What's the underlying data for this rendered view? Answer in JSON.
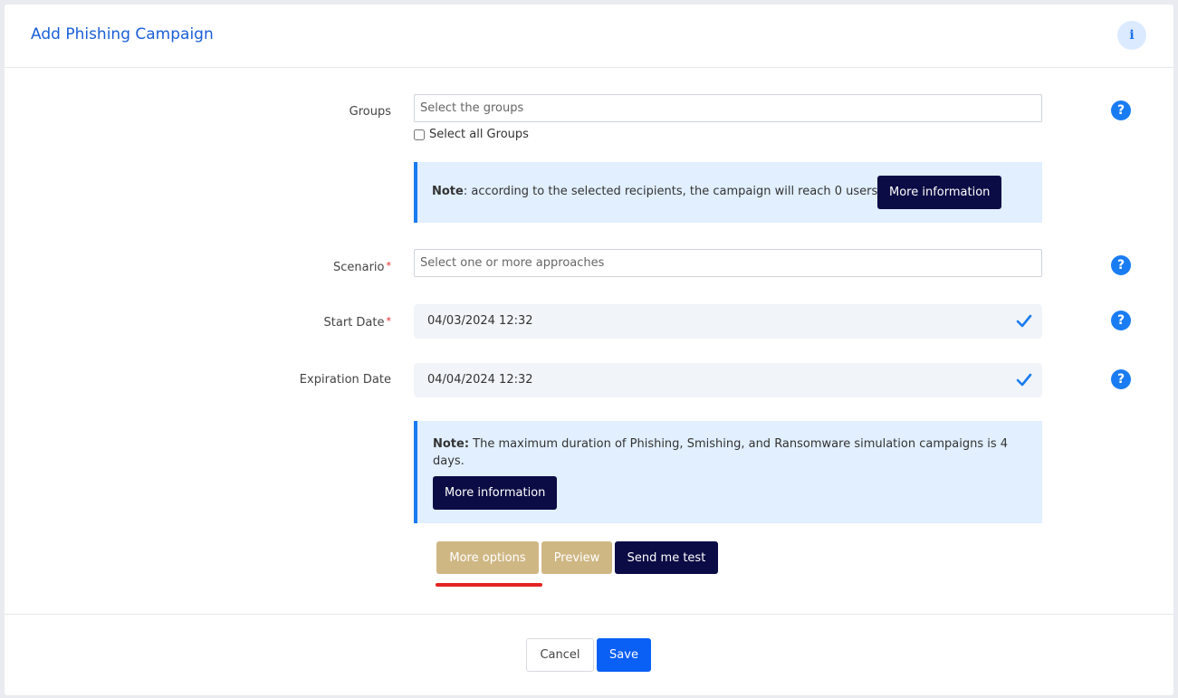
{
  "header": {
    "title": "Add Phishing Campaign",
    "info_icon": "i"
  },
  "groups": {
    "label": "Groups",
    "placeholder": "Select the groups",
    "select_all_label": "Select all Groups",
    "select_all_checked": false
  },
  "recipients_note": {
    "bold": "Note",
    "text": ": according to the selected recipients, the campaign will reach 0 users.",
    "button": "More information"
  },
  "scenario": {
    "label": "Scenario",
    "required_mark": "*",
    "placeholder": "Select one or more approaches"
  },
  "start_date": {
    "label": "Start Date",
    "required_mark": "*",
    "value": "04/03/2024 12:32"
  },
  "expiration_date": {
    "label": "Expiration Date",
    "value": "04/04/2024 12:32"
  },
  "duration_note": {
    "bold": "Note:",
    "text": " The maximum duration of Phishing, Smishing, and Ransomware simulation campaigns is 4 days.",
    "button": "More information"
  },
  "actions": {
    "more_options": "More options",
    "preview": "Preview",
    "send_test": "Send me test"
  },
  "help_glyph": "?",
  "footer": {
    "cancel": "Cancel",
    "save": "Save"
  },
  "colors": {
    "accent": "#1a7cf2",
    "title": "#1a5fd6",
    "dark_button": "#0b0b45",
    "tan_button": "#cfb784",
    "save_button": "#0a5ff5",
    "highlight": "#e52222"
  },
  "icons": {
    "info": "info-icon",
    "help": "question-circle-icon",
    "date_check": "checkmark-icon"
  }
}
